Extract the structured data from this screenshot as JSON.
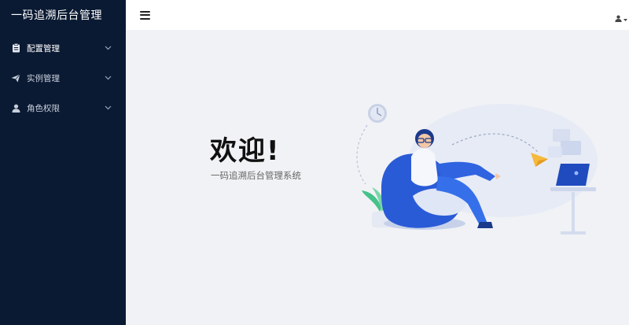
{
  "app": {
    "title": "一码追溯后台管理"
  },
  "sidebar": {
    "items": [
      {
        "label": "配置管理",
        "icon": "clipboard-icon",
        "active": true
      },
      {
        "label": "实例管理",
        "icon": "send-icon",
        "active": false
      },
      {
        "label": "角色权限",
        "icon": "user-icon",
        "active": false
      }
    ]
  },
  "header": {
    "menu_icon": "hamburger-icon",
    "user_icon": "user-icon"
  },
  "main": {
    "title": "欢迎!",
    "subtitle": "一码追溯后台管理系统"
  },
  "colors": {
    "sidebar_bg": "#0b1a33",
    "content_bg": "#f0f2f5",
    "accent": "#2a5bd7"
  }
}
